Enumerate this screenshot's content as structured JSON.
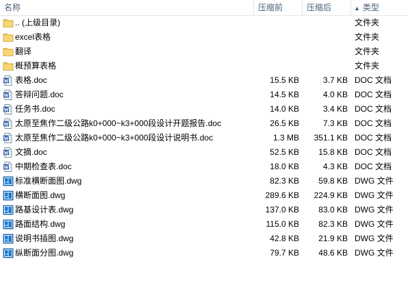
{
  "columns": {
    "name": "名称",
    "compressed": "压缩前",
    "after": "压缩后",
    "type": "类型",
    "type_sort": "▲"
  },
  "colors": {
    "folder": "#f4c44d",
    "doc": "#2b5fa8",
    "dwg": "#1f7ad1",
    "header_text": "#4c607a"
  },
  "rows": [
    {
      "name": ".. (上级目录)",
      "compressed": "",
      "after": "",
      "type": "文件夹",
      "icon": "folder-icon"
    },
    {
      "name": "excel表格",
      "compressed": "",
      "after": "",
      "type": "文件夹",
      "icon": "folder-icon"
    },
    {
      "name": "翻译",
      "compressed": "",
      "after": "",
      "type": "文件夹",
      "icon": "folder-icon"
    },
    {
      "name": "概预算表格",
      "compressed": "",
      "after": "",
      "type": "文件夹",
      "icon": "folder-icon"
    },
    {
      "name": "表格.doc",
      "compressed": "15.5 KB",
      "after": "3.7 KB",
      "type": "DOC 文档",
      "icon": "doc-icon"
    },
    {
      "name": "答辩问题.doc",
      "compressed": "14.5 KB",
      "after": "4.0 KB",
      "type": "DOC 文档",
      "icon": "doc-icon"
    },
    {
      "name": "任务书.doc",
      "compressed": "14.0 KB",
      "after": "3.4 KB",
      "type": "DOC 文档",
      "icon": "doc-icon"
    },
    {
      "name": "太原至焦作二级公路k0+000~k3+000段设计开题报告.doc",
      "compressed": "26.5 KB",
      "after": "7.3 KB",
      "type": "DOC 文档",
      "icon": "doc-icon"
    },
    {
      "name": "太原至焦作二级公路k0+000~k3+000段设计说明书.doc",
      "compressed": "1.3 MB",
      "after": "351.1 KB",
      "type": "DOC 文档",
      "icon": "doc-icon"
    },
    {
      "name": "文摘.doc",
      "compressed": "52.5 KB",
      "after": "15.8 KB",
      "type": "DOC 文档",
      "icon": "doc-icon"
    },
    {
      "name": "中期检查表.doc",
      "compressed": "18.0 KB",
      "after": "4.3 KB",
      "type": "DOC 文档",
      "icon": "doc-icon"
    },
    {
      "name": "标准横断面图.dwg",
      "compressed": "82.3 KB",
      "after": "59.8 KB",
      "type": "DWG 文件",
      "icon": "dwg-icon"
    },
    {
      "name": "横断面图.dwg",
      "compressed": "289.6 KB",
      "after": "224.9 KB",
      "type": "DWG 文件",
      "icon": "dwg-icon"
    },
    {
      "name": "路基设计表.dwg",
      "compressed": "137.0 KB",
      "after": "83.0 KB",
      "type": "DWG 文件",
      "icon": "dwg-icon"
    },
    {
      "name": "路面结构.dwg",
      "compressed": "115.0 KB",
      "after": "82.3 KB",
      "type": "DWG 文件",
      "icon": "dwg-icon"
    },
    {
      "name": "说明书插图.dwg",
      "compressed": "42.8 KB",
      "after": "21.9 KB",
      "type": "DWG 文件",
      "icon": "dwg-icon"
    },
    {
      "name": "纵断面分图.dwg",
      "compressed": "79.7 KB",
      "after": "48.6 KB",
      "type": "DWG 文件",
      "icon": "dwg-icon"
    }
  ]
}
